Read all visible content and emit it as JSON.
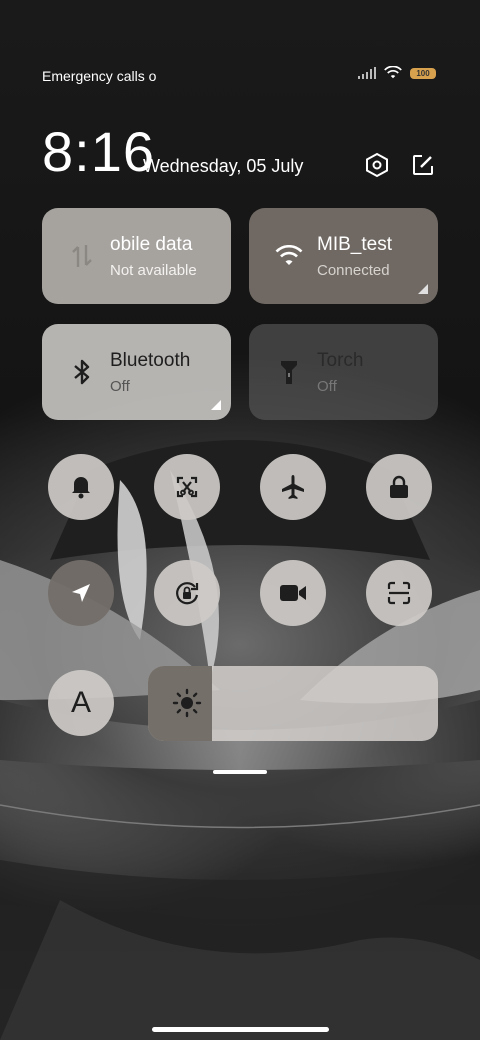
{
  "status_bar": {
    "carrier_text": "Emergency calls o",
    "battery": "100",
    "battery_color": "#d8a14d"
  },
  "header": {
    "time": "8:16",
    "date": "Wednesday, 05 July",
    "settings_icon": "hexagon-settings-icon",
    "edit_icon": "edit-icon"
  },
  "tiles": [
    {
      "title": "obile data",
      "subtitle": "Not available",
      "icon": "mobile-data-icon",
      "state": "unavailable"
    },
    {
      "title": "MIB_test",
      "subtitle": "Connected",
      "icon": "wifi-icon",
      "state": "on"
    },
    {
      "title": "Bluetooth",
      "subtitle": "Off",
      "icon": "bluetooth-icon",
      "state": "off"
    },
    {
      "title": "Torch",
      "subtitle": "Off",
      "icon": "torch-icon",
      "state": "off"
    }
  ],
  "toggles": [
    {
      "icon": "bell-icon",
      "state": "off"
    },
    {
      "icon": "screenshot-icon",
      "state": "off"
    },
    {
      "icon": "airplane-icon",
      "state": "off"
    },
    {
      "icon": "lock-icon",
      "state": "off"
    },
    {
      "icon": "location-icon",
      "state": "on"
    },
    {
      "icon": "rotation-lock-icon",
      "state": "off"
    },
    {
      "icon": "video-camera-icon",
      "state": "off"
    },
    {
      "icon": "scan-icon",
      "state": "off"
    },
    {
      "icon": "font-icon",
      "label": "A",
      "state": "off"
    }
  ],
  "brightness": {
    "level": 0.22,
    "icon": "brightness-icon"
  },
  "colors": {
    "accent_dark": "#736e69",
    "tile_light": "#bebab6"
  }
}
